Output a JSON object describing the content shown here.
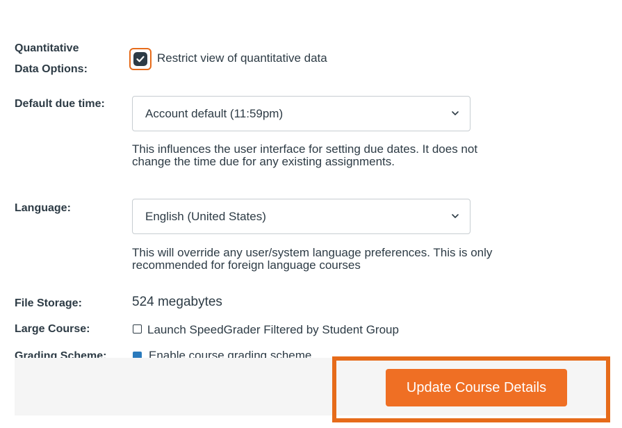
{
  "quantitative": {
    "label": "Quantitative Data Options:",
    "label_line1": "Quantitative",
    "label_line2": "Data Options:",
    "checkbox_label": "Restrict view of quantitative data",
    "checked": true
  },
  "due_time": {
    "label": "Default due time:",
    "selected": "Account default (11:59pm)",
    "help_line1": "This influences the user interface for setting due dates. It does not",
    "help_line2": "change the time due for any existing assignments."
  },
  "language": {
    "label": "Language:",
    "selected": "English (United States)",
    "help_line1": "This will override any user/system language preferences. This is only",
    "help_line2": "recommended for foreign language courses"
  },
  "file_storage": {
    "label": "File Storage:",
    "value": "524 megabytes"
  },
  "large_course": {
    "label": "Large Course:",
    "checkbox_label": "Launch SpeedGrader Filtered by Student Group",
    "checked": false
  },
  "grading_scheme": {
    "label": "Grading Scheme:",
    "checkbox_label": "Enable course grading scheme",
    "checked": true
  },
  "footer": {
    "update_button": "Update Course Details"
  },
  "colors": {
    "accent": "#ef6f24",
    "highlight": "#e66b1a",
    "text": "#2d3b45"
  }
}
